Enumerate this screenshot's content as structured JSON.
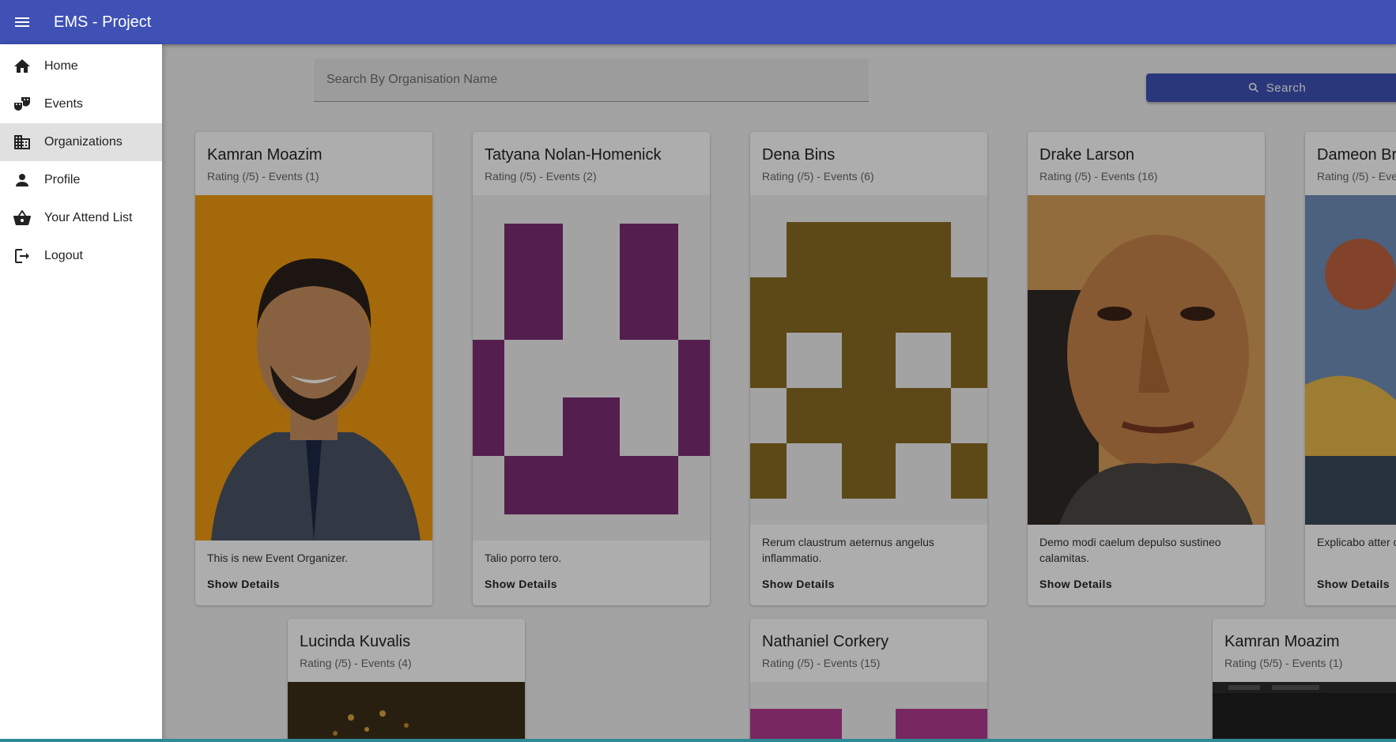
{
  "appbar": {
    "title": "EMS - Project",
    "color": "#3f51b5"
  },
  "drawer": {
    "items": [
      {
        "label": "Home",
        "icon": "home-icon"
      },
      {
        "label": "Events",
        "icon": "theater-masks-icon"
      },
      {
        "label": "Organizations",
        "icon": "business-icon",
        "active": true
      },
      {
        "label": "Profile",
        "icon": "person-icon"
      },
      {
        "label": "Your Attend List",
        "icon": "basket-icon"
      },
      {
        "label": "Logout",
        "icon": "logout-icon"
      }
    ]
  },
  "search": {
    "placeholder": "Search By Organisation Name",
    "value": "",
    "button_label": "Search"
  },
  "cards": [
    {
      "name": "Kamran Moazim",
      "meta": "Rating (/5) - Events (1)",
      "description": "This is new Event Organizer.",
      "action": "Show Details"
    },
    {
      "name": "Tatyana Nolan-Homenick",
      "meta": "Rating (/5) - Events (2)",
      "description": "Talio porro tero.",
      "action": "Show Details"
    },
    {
      "name": "Dena Bins",
      "meta": "Rating (/5) - Events (6)",
      "description": "Rerum claustrum aeternus angelus inflammatio.",
      "action": "Show Details"
    },
    {
      "name": "Drake Larson",
      "meta": "Rating (/5) - Events (16)",
      "description": "Demo modi caelum depulso sustineo calamitas.",
      "action": "Show Details"
    },
    {
      "name": "Dameon Br",
      "meta": "Rating (/5) - Eve",
      "description": "Explicabo atter condico pecus.",
      "action": "Show Details"
    },
    {
      "name": "Lucinda Kuvalis",
      "meta": "Rating (/5) - Events (4)"
    },
    {
      "name": "Nathaniel Corkery",
      "meta": "Rating (/5) - Events (15)"
    },
    {
      "name": "Kamran Moazim",
      "meta": "Rating (5/5) - Events (1)"
    }
  ]
}
